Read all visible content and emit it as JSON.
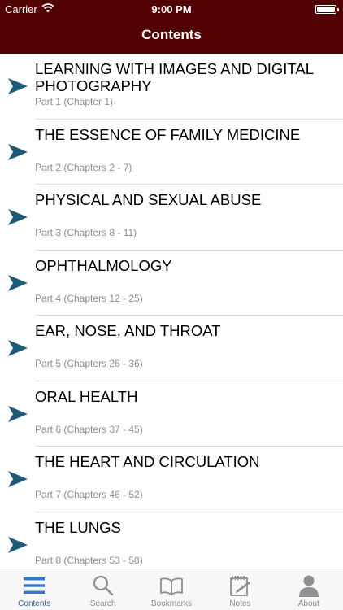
{
  "status": {
    "carrier": "Carrier",
    "time": "9:00 PM"
  },
  "nav": {
    "title": "Contents"
  },
  "contents": [
    {
      "title": "LEARNING WITH IMAGES AND DIGITAL PHOTOGRAPHY",
      "subtitle": "Part 1 (Chapter 1)"
    },
    {
      "title": "THE ESSENCE OF FAMILY MEDICINE",
      "subtitle": "Part 2 (Chapters 2 - 7)"
    },
    {
      "title": "PHYSICAL AND SEXUAL ABUSE",
      "subtitle": "Part 3 (Chapters 8 - 11)"
    },
    {
      "title": "OPHTHALMOLOGY",
      "subtitle": "Part 4 (Chapters 12 - 25)"
    },
    {
      "title": "EAR, NOSE, AND THROAT",
      "subtitle": "Part 5 (Chapters 26 - 36)"
    },
    {
      "title": "ORAL HEALTH",
      "subtitle": "Part 6 (Chapters 37 - 45)"
    },
    {
      "title": "THE HEART AND CIRCULATION",
      "subtitle": "Part 7 (Chapters 46 - 52)"
    },
    {
      "title": "THE LUNGS",
      "subtitle": "Part 8 (Chapters 53 - 58)"
    }
  ],
  "tabs": [
    {
      "label": "Contents",
      "icon": "list-icon",
      "active": true
    },
    {
      "label": "Search",
      "icon": "search-icon",
      "active": false
    },
    {
      "label": "Bookmarks",
      "icon": "book-icon",
      "active": false
    },
    {
      "label": "Notes",
      "icon": "notepad-icon",
      "active": false
    },
    {
      "label": "About",
      "icon": "person-icon",
      "active": false
    }
  ],
  "colors": {
    "nav_bar": "#520202",
    "arrow": "#1e5a78",
    "tab_active": "#2f5f9c",
    "tab_inactive": "#8e8e93"
  }
}
